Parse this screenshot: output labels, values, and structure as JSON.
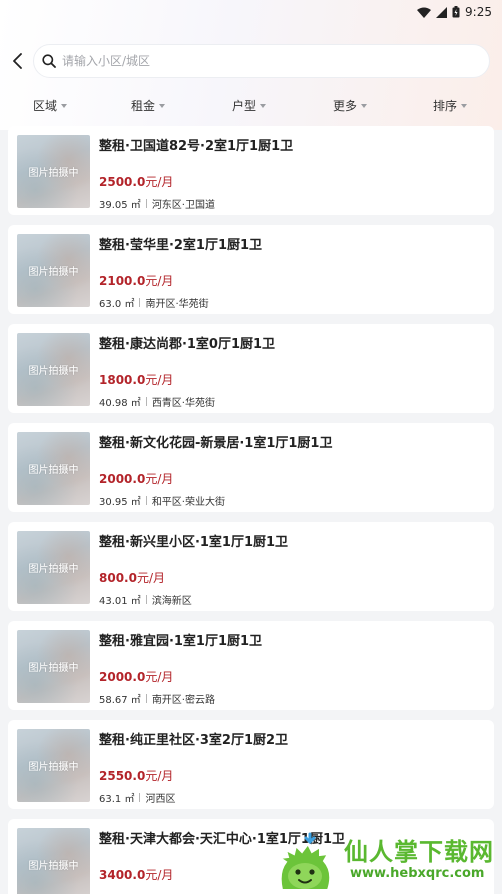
{
  "status_bar": {
    "time": "9:25"
  },
  "search": {
    "placeholder": "请输入小区/城区"
  },
  "filters": [
    {
      "label": "区域"
    },
    {
      "label": "租金"
    },
    {
      "label": "户型"
    },
    {
      "label": "更多"
    },
    {
      "label": "排序"
    }
  ],
  "listings": [
    {
      "image_label": "图片拍摄中",
      "title": "整租·卫国道82号·2室1厅1厨1卫",
      "price": "2500.0",
      "unit": "元/月",
      "area": "39.05 ㎡",
      "location": "河东区·卫国道"
    },
    {
      "image_label": "图片拍摄中",
      "title": "整租·莹华里·2室1厅1厨1卫",
      "price": "2100.0",
      "unit": "元/月",
      "area": "63.0 ㎡",
      "location": "南开区·华苑街"
    },
    {
      "image_label": "图片拍摄中",
      "title": "整租·康达尚郡·1室0厅1厨1卫",
      "price": "1800.0",
      "unit": "元/月",
      "area": "40.98 ㎡",
      "location": "西青区·华苑街"
    },
    {
      "image_label": "图片拍摄中",
      "title": "整租·新文化花园-新景居·1室1厅1厨1卫",
      "price": "2000.0",
      "unit": "元/月",
      "area": "30.95 ㎡",
      "location": "和平区·荣业大街"
    },
    {
      "image_label": "图片拍摄中",
      "title": "整租·新兴里小区·1室1厅1厨1卫",
      "price": "800.0",
      "unit": "元/月",
      "area": "43.01 ㎡",
      "location": "滨海新区"
    },
    {
      "image_label": "图片拍摄中",
      "title": "整租·雅宜园·1室1厅1厨1卫",
      "price": "2000.0",
      "unit": "元/月",
      "area": "58.67 ㎡",
      "location": "南开区·密云路"
    },
    {
      "image_label": "图片拍摄中",
      "title": "整租·纯正里社区·3室2厅1厨2卫",
      "price": "2550.0",
      "unit": "元/月",
      "area": "63.1 ㎡",
      "location": "河西区"
    },
    {
      "image_label": "图片拍摄中",
      "title": "整租·天津大都会·天汇中心·1室1厅1厨1卫",
      "price": "3400.0",
      "unit": "元/月",
      "area": "",
      "location": ""
    }
  ],
  "watermark": {
    "name": "仙人掌下载网",
    "url": "www.hebxqrc.com"
  }
}
